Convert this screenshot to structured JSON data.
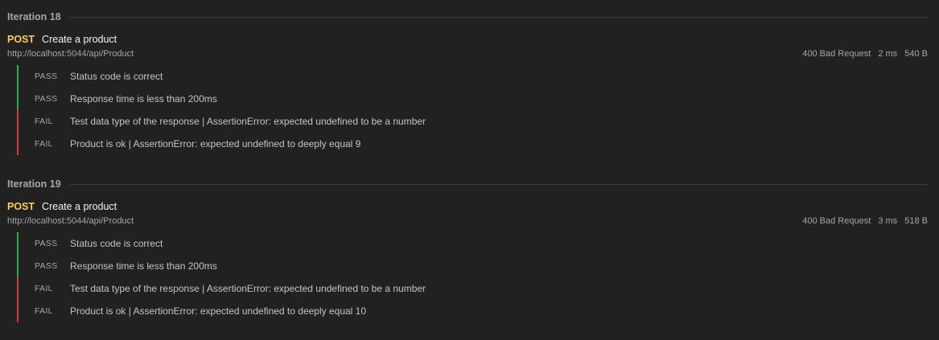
{
  "iterations": [
    {
      "title": "Iteration 18",
      "method": "POST",
      "name": "Create a product",
      "url": "http://localhost:5044/api/Product",
      "status": "400 Bad Request",
      "time": "2 ms",
      "size": "540 B",
      "tests": [
        {
          "result": "PASS",
          "text": "Status code is correct"
        },
        {
          "result": "PASS",
          "text": "Response time is less than 200ms"
        },
        {
          "result": "FAIL",
          "text": "Test data type of the response | AssertionError: expected undefined to be a number"
        },
        {
          "result": "FAIL",
          "text": "Product is ok | AssertionError: expected undefined to deeply equal 9"
        }
      ]
    },
    {
      "title": "Iteration 19",
      "method": "POST",
      "name": "Create a product",
      "url": "http://localhost:5044/api/Product",
      "status": "400 Bad Request",
      "time": "3 ms",
      "size": "518 B",
      "tests": [
        {
          "result": "PASS",
          "text": "Status code is correct"
        },
        {
          "result": "PASS",
          "text": "Response time is less than 200ms"
        },
        {
          "result": "FAIL",
          "text": "Test data type of the response | AssertionError: expected undefined to be a number"
        },
        {
          "result": "FAIL",
          "text": "Product is ok | AssertionError: expected undefined to deeply equal 10"
        }
      ]
    }
  ],
  "colors": {
    "background": "#212121",
    "method": "#ffc95e",
    "pass": "#2fa84f",
    "fail": "#d23b3b"
  }
}
